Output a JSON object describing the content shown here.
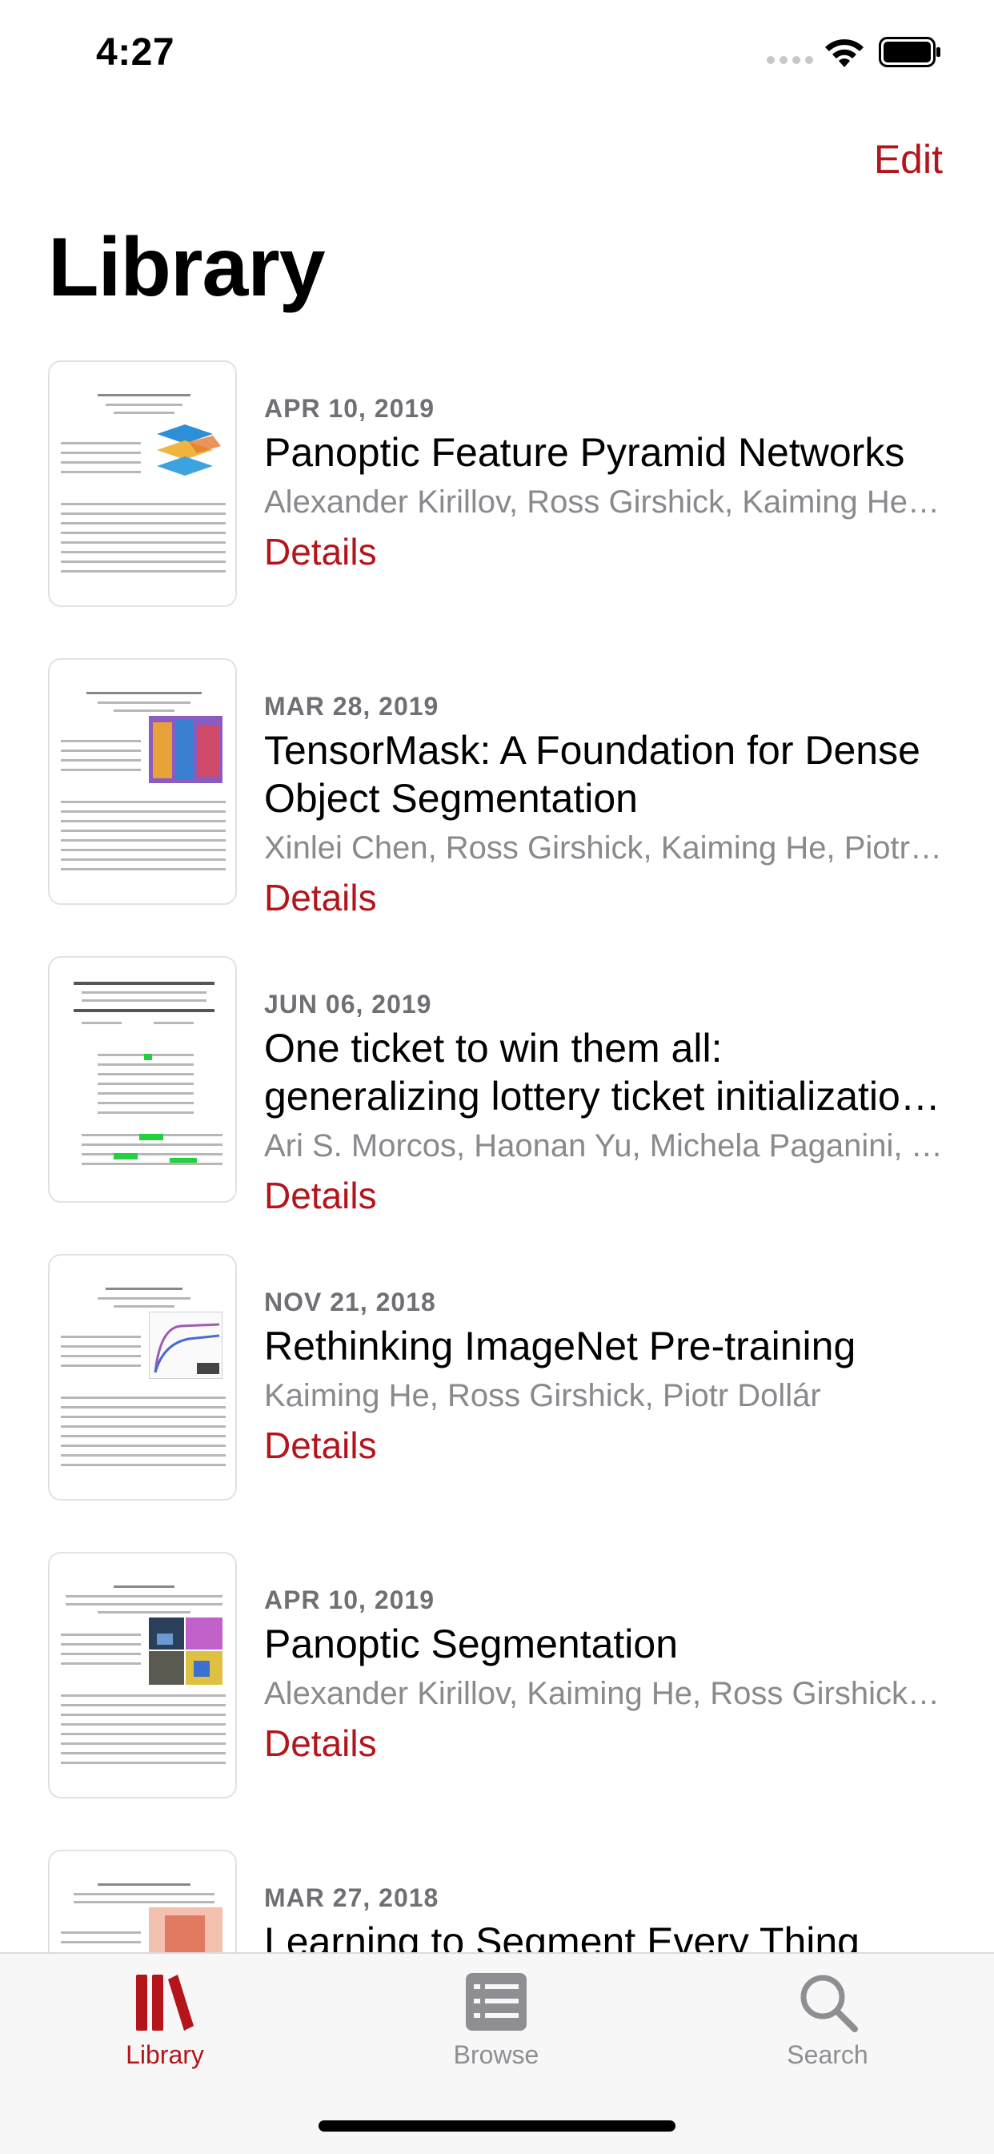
{
  "status": {
    "time": "4:27"
  },
  "nav": {
    "edit_label": "Edit",
    "title": "Library"
  },
  "papers": [
    {
      "date": "APR 10, 2019",
      "title": "Panoptic Feature Pyramid Networks",
      "authors": "Alexander Kirillov, Ross Girshick, Kaiming He, Piotr Dollár",
      "details": "Details"
    },
    {
      "date": "MAR 28, 2019",
      "title": "TensorMask: A Foundation for Dense Object Segmentation",
      "authors": "Xinlei Chen, Ross Girshick, Kaiming He, Piotr Dollár",
      "details": "Details"
    },
    {
      "date": "JUN 06, 2019",
      "title": "One ticket to win them all: generalizing lottery ticket initializations across datasets and optimizers",
      "authors": "Ari S. Morcos, Haonan Yu, Michela Paganini, Yuandong Tian",
      "details": "Details"
    },
    {
      "date": "NOV 21, 2018",
      "title": "Rethinking ImageNet Pre-training",
      "authors": "Kaiming He, Ross Girshick, Piotr Dollár",
      "details": "Details"
    },
    {
      "date": "APR 10, 2019",
      "title": "Panoptic Segmentation",
      "authors": "Alexander Kirillov, Kaiming He, Ross Girshick, Carsten Rother, Piotr Dollár",
      "details": "Details"
    },
    {
      "date": "MAR 27, 2018",
      "title": "Learning to Segment Every Thing",
      "authors": "",
      "details": ""
    }
  ],
  "tabs": [
    {
      "label": "Library",
      "icon": "library-books-icon",
      "active": true
    },
    {
      "label": "Browse",
      "icon": "list-icon",
      "active": false
    },
    {
      "label": "Search",
      "icon": "magnifier-icon",
      "active": false
    }
  ],
  "colors": {
    "accent": "#b3151b",
    "inactive_tab": "#8e8e93",
    "secondary_text": "#8a8a8e",
    "date_text": "#6f6f74"
  }
}
